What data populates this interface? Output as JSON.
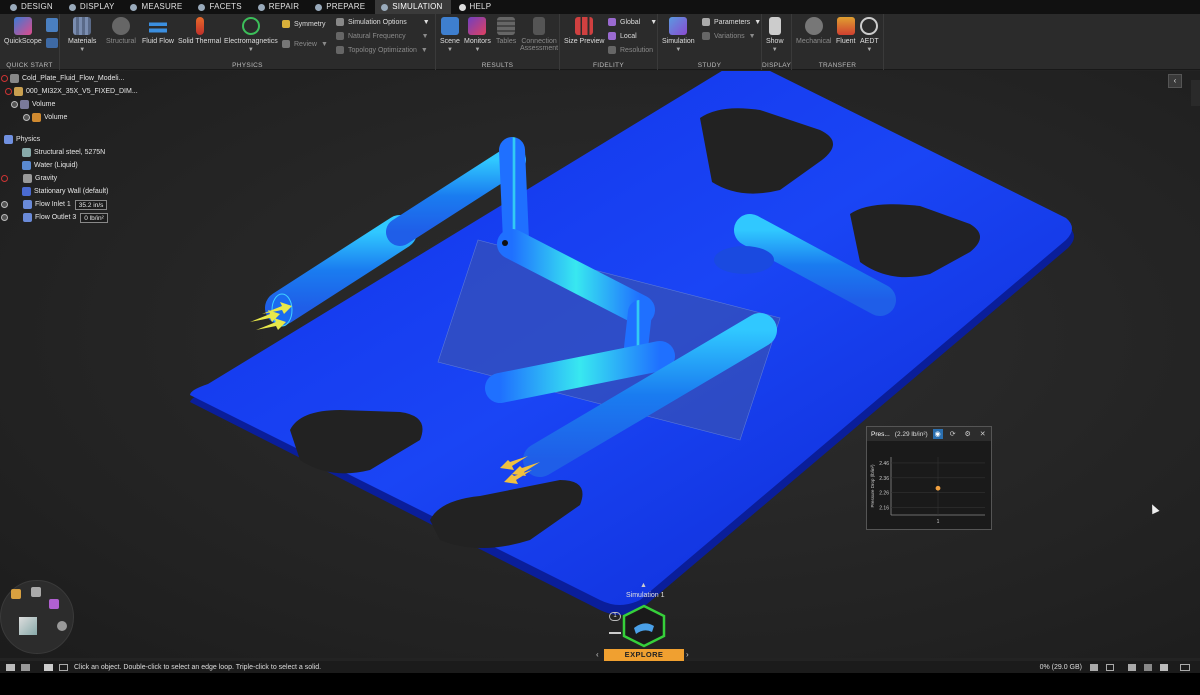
{
  "menu": {
    "tabs": [
      {
        "label": "Design",
        "icon": "design-icon"
      },
      {
        "label": "Display",
        "icon": "display-icon"
      },
      {
        "label": "Measure",
        "icon": "measure-icon"
      },
      {
        "label": "Facets",
        "icon": "facets-icon"
      },
      {
        "label": "Repair",
        "icon": "repair-icon"
      },
      {
        "label": "Prepare",
        "icon": "prepare-icon"
      },
      {
        "label": "Simulation",
        "icon": "simulation-icon"
      },
      {
        "label": "Help",
        "icon": "help-icon"
      }
    ],
    "active": "Simulation"
  },
  "ribbon": {
    "quick_start": {
      "label": "Quick Start",
      "quickscope": "QuickScope"
    },
    "physics": {
      "label": "Physics",
      "materials": "Materials",
      "structural": "Structural",
      "fluid_flow": "Fluid Flow",
      "solid_thermal": "Solid Thermal",
      "electromagnetics": "Electromagnetics",
      "symmetry": "Symmetry",
      "review": "Review"
    },
    "sim_options": {
      "simulation_options": "Simulation Options",
      "natural_frequency": "Natural Frequency",
      "topology_optimization": "Topology Optimization"
    },
    "results": {
      "label": "Results",
      "scene": "Scene",
      "monitors": "Monitors",
      "tables": "Tables",
      "connection": "Connection",
      "assessment": "Assessment"
    },
    "fidelity": {
      "label": "Fidelity",
      "size_preview": "Size Preview",
      "global": "Global",
      "local": "Local",
      "resolution": "Resolution"
    },
    "study": {
      "label": "Study",
      "simulation": "Simulation",
      "parameters": "Parameters",
      "variations": "Variations"
    },
    "display": {
      "label": "Display",
      "show": "Show"
    },
    "transfer": {
      "label": "Transfer",
      "mechanical": "Mechanical",
      "fluent": "Fluent",
      "aedt": "AEDT"
    }
  },
  "tree": {
    "items": [
      {
        "label": "Cold_Plate_Fluid_Flow_Modeli..."
      },
      {
        "label": "000_MI32X_35X_V5_FIXED_DIM..."
      },
      {
        "label": "Volume"
      },
      {
        "label": "Volume"
      }
    ],
    "physics_title": "Physics",
    "physics_items": [
      {
        "label": "Structural steel, 5275N",
        "value": ""
      },
      {
        "label": "Water (Liquid)",
        "value": ""
      },
      {
        "label": "Gravity",
        "value": ""
      },
      {
        "label": "Stationary Wall (default)",
        "value": ""
      },
      {
        "label": "Flow Inlet 1",
        "value": "35.2 in/s"
      },
      {
        "label": "Flow Outlet 3",
        "value": "0 lb/in²"
      }
    ]
  },
  "monitor": {
    "title": "Pres...",
    "value": "(2.29 lb/in²)",
    "ylabel": "Pressure Drop (lb/in²)",
    "close": "✕"
  },
  "chart_data": {
    "type": "scatter",
    "x": [
      1
    ],
    "y": [
      2.29
    ],
    "yticks": [
      2.46,
      2.36,
      2.26,
      2.16
    ],
    "xticks": [
      1
    ],
    "ylim": [
      2.11,
      2.5
    ],
    "xlim": [
      0,
      2
    ],
    "ylabel": "Pressure Drop (lb/in²)",
    "title": "Pres...",
    "color": "#f0a040"
  },
  "tool_guide": {
    "simulation_label": "Simulation 1",
    "explore": "Explore",
    "badge": "1"
  },
  "status": {
    "message": "Click an object. Double-click to select an edge loop. Triple-click to select a solid.",
    "memory": "0% (29.0 GB)"
  }
}
